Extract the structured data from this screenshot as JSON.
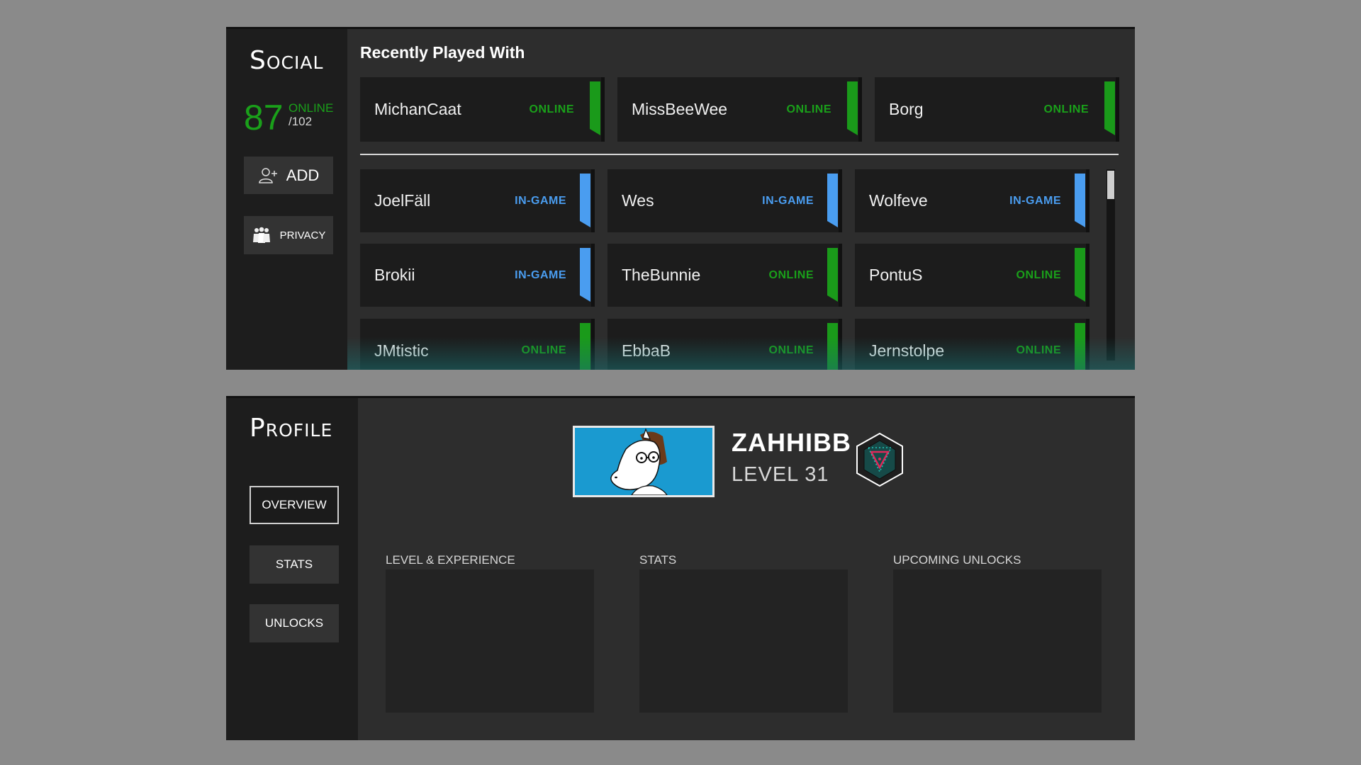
{
  "social": {
    "title": "Social",
    "online_count": "87",
    "online_label": "ONLINE",
    "total_label": "/102",
    "add_label": "ADD",
    "privacy_label": "PRIVACY",
    "recent_title": "Recently Played With",
    "recent": [
      {
        "name": "MichanCaat",
        "status": "ONLINE"
      },
      {
        "name": "MissBeeWee",
        "status": "ONLINE"
      },
      {
        "name": "Borg",
        "status": "ONLINE"
      }
    ],
    "friends": [
      {
        "name": "JoelFäll",
        "status": "IN-GAME"
      },
      {
        "name": "Wes",
        "status": "IN-GAME"
      },
      {
        "name": "Wolfeve",
        "status": "IN-GAME"
      },
      {
        "name": "Brokii",
        "status": "IN-GAME"
      },
      {
        "name": "TheBunnie",
        "status": "ONLINE"
      },
      {
        "name": "PontuS",
        "status": "ONLINE"
      },
      {
        "name": "JMtistic",
        "status": "ONLINE"
      },
      {
        "name": "EbbaB",
        "status": "ONLINE"
      },
      {
        "name": "Jernstolpe",
        "status": "ONLINE"
      }
    ],
    "colors": {
      "online": "#1aa01a",
      "ingame": "#4a9df0"
    }
  },
  "profile": {
    "title": "Profile",
    "nav": [
      {
        "label": "OVERVIEW",
        "active": true
      },
      {
        "label": "STATS",
        "active": false
      },
      {
        "label": "UNLOCKS",
        "active": false
      }
    ],
    "username": "ZAHHIBB",
    "level": "LEVEL 31",
    "sections": [
      {
        "label": "LEVEL & EXPERIENCE"
      },
      {
        "label": "STATS"
      },
      {
        "label": "UPCOMING UNLOCKS"
      }
    ]
  }
}
